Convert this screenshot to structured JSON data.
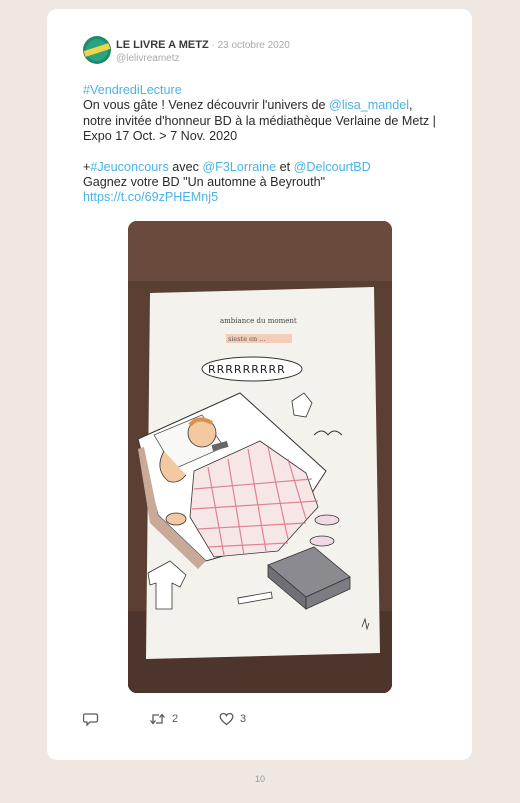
{
  "tweet": {
    "display_name": "LE LIVRE A METZ",
    "separator": " · ",
    "date": "23 octobre 2020",
    "handle": "@lelivreametz",
    "text": {
      "hashtag1": "#VendrediLecture",
      "line_a": "On vous gâte ! Venez découvrir l'univers de ",
      "mention1": "@lisa_mandel",
      "line_b": ", notre invitée d'honneur BD à la médiathèque Verlaine de Metz | Expo 17 Oct. > 7 Nov. 2020",
      "plus": "+",
      "hashtag2": "#Jeuconcours",
      "avec": " avec ",
      "mention2": "@F3Lorraine",
      "et": " et ",
      "mention3": "@DelcourtBD",
      "line_c": "Gagnez votre BD \"Un automne à Beyrouth\"",
      "url": "https://t.co/69zPHEMnj5"
    },
    "image": {
      "caption_top": "ambiance du moment",
      "caption_sub": "sieste en ... ",
      "snore": "RRRRRRRRR"
    },
    "actions": {
      "reply_icon": "reply-icon",
      "retweet_icon": "retweet-icon",
      "retweet_count": "2",
      "like_icon": "heart-icon",
      "like_count": "3"
    },
    "colors": {
      "link": "#4ab3e6",
      "background": "#efe7e2"
    }
  },
  "page_number": "10"
}
